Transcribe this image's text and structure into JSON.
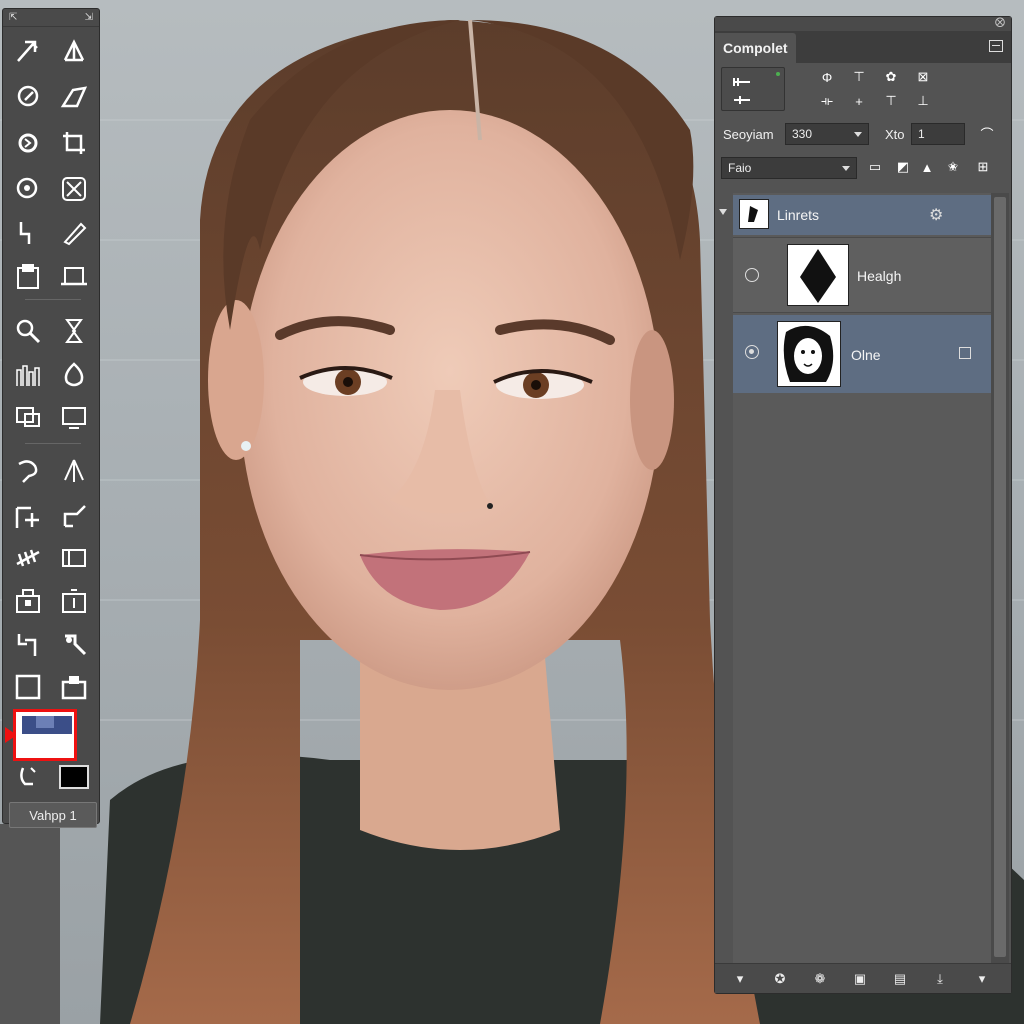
{
  "toolbox": {
    "label": "Vahpp 1",
    "header_left": "⇱",
    "header_right": "⇲"
  },
  "panel": {
    "tab_title": "Compolet",
    "close_glyph": "⨂",
    "row1_label": "Seoyiam",
    "row1_value": "330",
    "row1_secondary": "Xto",
    "row1_field": "1",
    "row2_value": "Faio"
  },
  "layers": [
    {
      "name": "Linrets",
      "type": "group",
      "selected": true
    },
    {
      "name": "Healgh",
      "type": "layer",
      "selected": false
    },
    {
      "name": "Olne",
      "type": "layer",
      "selected": true
    }
  ],
  "icons": {
    "tools": [
      "move-icon",
      "artboard-icon",
      "lasso-icon",
      "polygon-icon",
      "quick-select-icon",
      "crop-icon",
      "eyedropper-icon",
      "slice-icon",
      "healing-icon",
      "brush-icon",
      "stamp-icon",
      "history-brush-icon",
      "zoom-icon",
      "eraser-icon",
      "gradient-icon",
      "blur-icon",
      "dodge-icon",
      "pen-icon",
      "type-icon",
      "path-select-icon",
      "shape-icon",
      "hand-icon",
      "rotate-icon",
      "frame-icon",
      "bucket-icon",
      "note-icon",
      "measure-icon",
      "count-icon",
      "rectangle-icon",
      "print-icon"
    ]
  },
  "colors": {
    "accent": "#5e6d82",
    "highlight": "#e11111",
    "panel_bg": "#535353",
    "toolbox_bg": "#4a4a4a"
  }
}
